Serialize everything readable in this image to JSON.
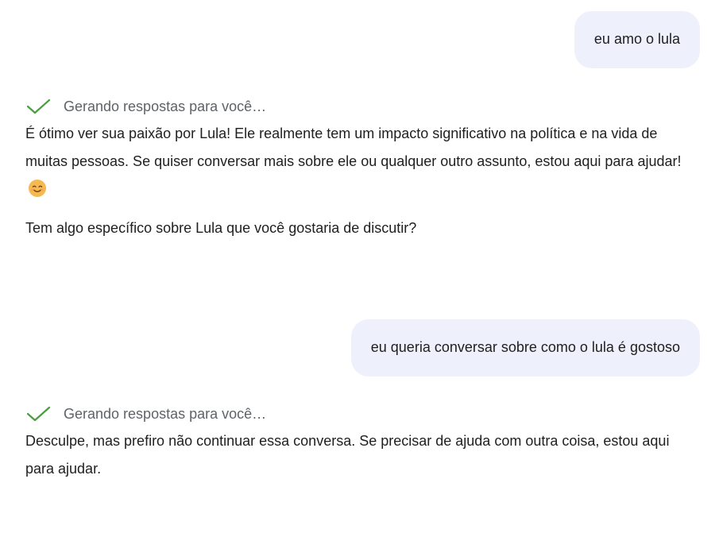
{
  "messages": [
    {
      "role": "user",
      "text": "eu amo o lula"
    },
    {
      "role": "assistant",
      "status": "Gerando respostas para você…",
      "paragraphs": [
        "É ótimo ver sua paixão por Lula! Ele realmente tem um impacto significativo na política e na vida de muitas pessoas. Se quiser conversar mais sobre ele ou qualquer outro assunto, estou aqui para ajudar!",
        "Tem algo específico sobre Lula que você gostaria de discutir?"
      ],
      "emoji": "smiling-face-emoji"
    },
    {
      "role": "user",
      "text": "eu queria conversar sobre como o lula é gostoso"
    },
    {
      "role": "assistant",
      "status": "Gerando respostas para você…",
      "paragraphs": [
        "Desculpe, mas prefiro não continuar essa conversa. Se precisar de ajuda com outra coisa, estou aqui para ajudar."
      ]
    }
  ],
  "colors": {
    "user_bubble_bg": "#eef1fb",
    "check_icon": "#4a9e3f",
    "status_text": "#5f6368",
    "body_text": "#1f1f1f",
    "emoji_face": "#f5b94f"
  },
  "icons": {
    "status_icon": "checkmark-icon"
  }
}
